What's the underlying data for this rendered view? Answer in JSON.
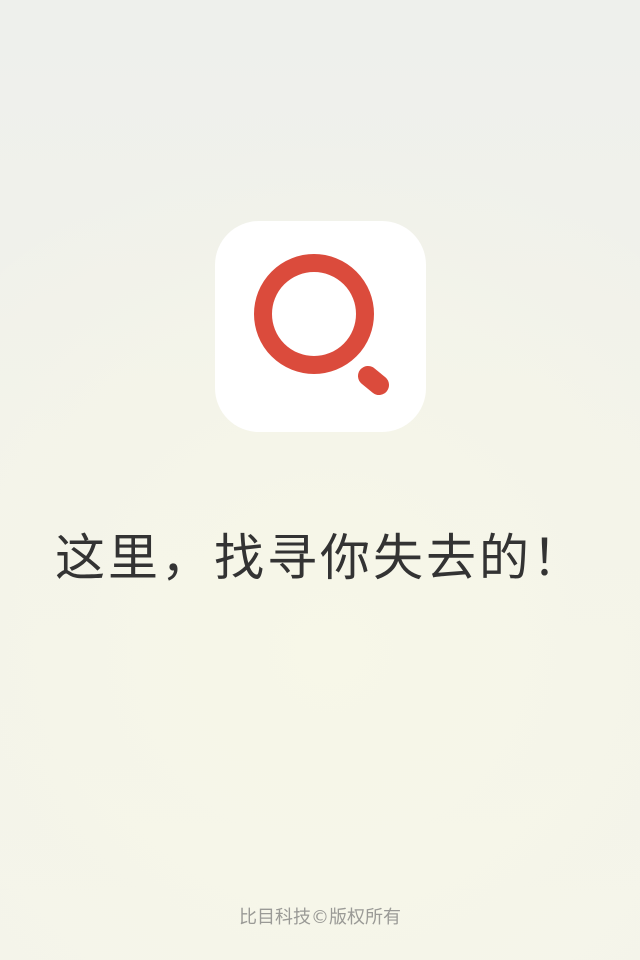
{
  "splash": {
    "logo_icon": "magnifier-icon",
    "slogan": "这里，找寻你失去的！",
    "copyright": "比目科技©版权所有"
  },
  "colors": {
    "logo_red": "#db4b3c",
    "logo_background": "#ffffff",
    "slogan_text": "#333333",
    "copyright_text": "#9a9a96"
  }
}
